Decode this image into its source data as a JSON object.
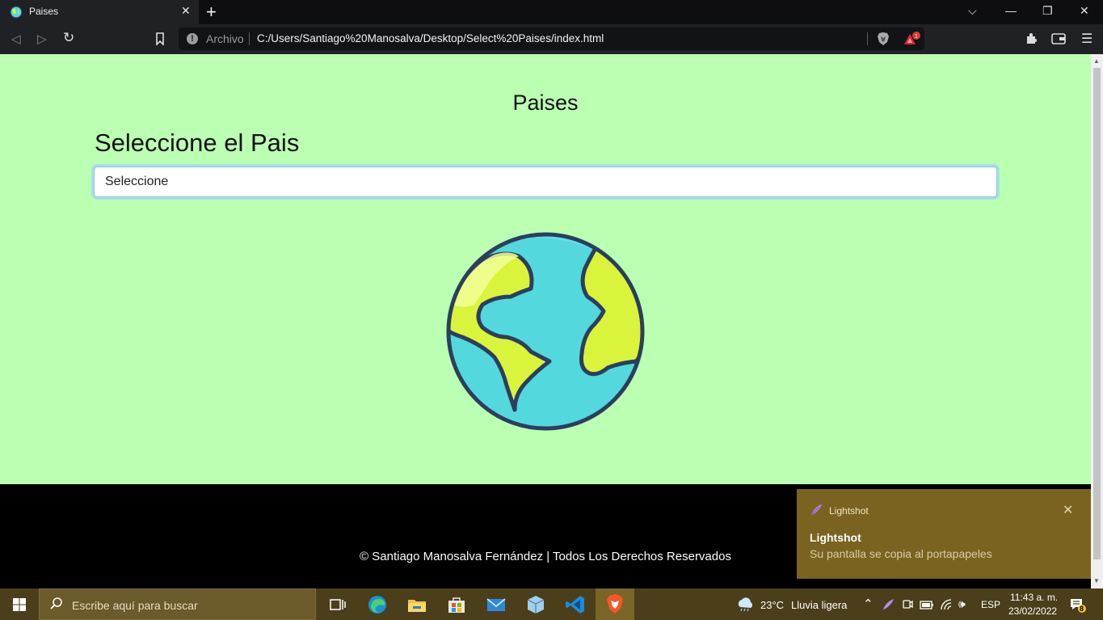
{
  "browser": {
    "tab_title": "Paises",
    "address_prefix": "Archivo",
    "address_url": "C:/Users/Santiago%20Manosalva/Desktop/Select%20Paises/index.html",
    "rewards_badge": "1"
  },
  "page": {
    "title": "Paises",
    "select_label": "Seleccione el Pais",
    "select_value": "Seleccione"
  },
  "footer": {
    "copyright": "© Santiago Manosalva Fernández | Todos Los Derechos Reservados"
  },
  "notification": {
    "app_name": "Lightshot",
    "heading": "Lightshot",
    "body": "Su pantalla se copia al portapapeles"
  },
  "taskbar": {
    "search_placeholder": "Escribe aquí para buscar",
    "weather_temp": "23°C",
    "weather_desc": "Lluvia ligera",
    "language": "ESP",
    "time": "11:43 a. m.",
    "date": "23/02/2022",
    "notification_count": "8"
  },
  "colors": {
    "page_bg": "#bbffb3",
    "footer_bg": "#000000",
    "toast_bg": "#7a6320",
    "taskbar_bg": "#4a3f1a"
  }
}
